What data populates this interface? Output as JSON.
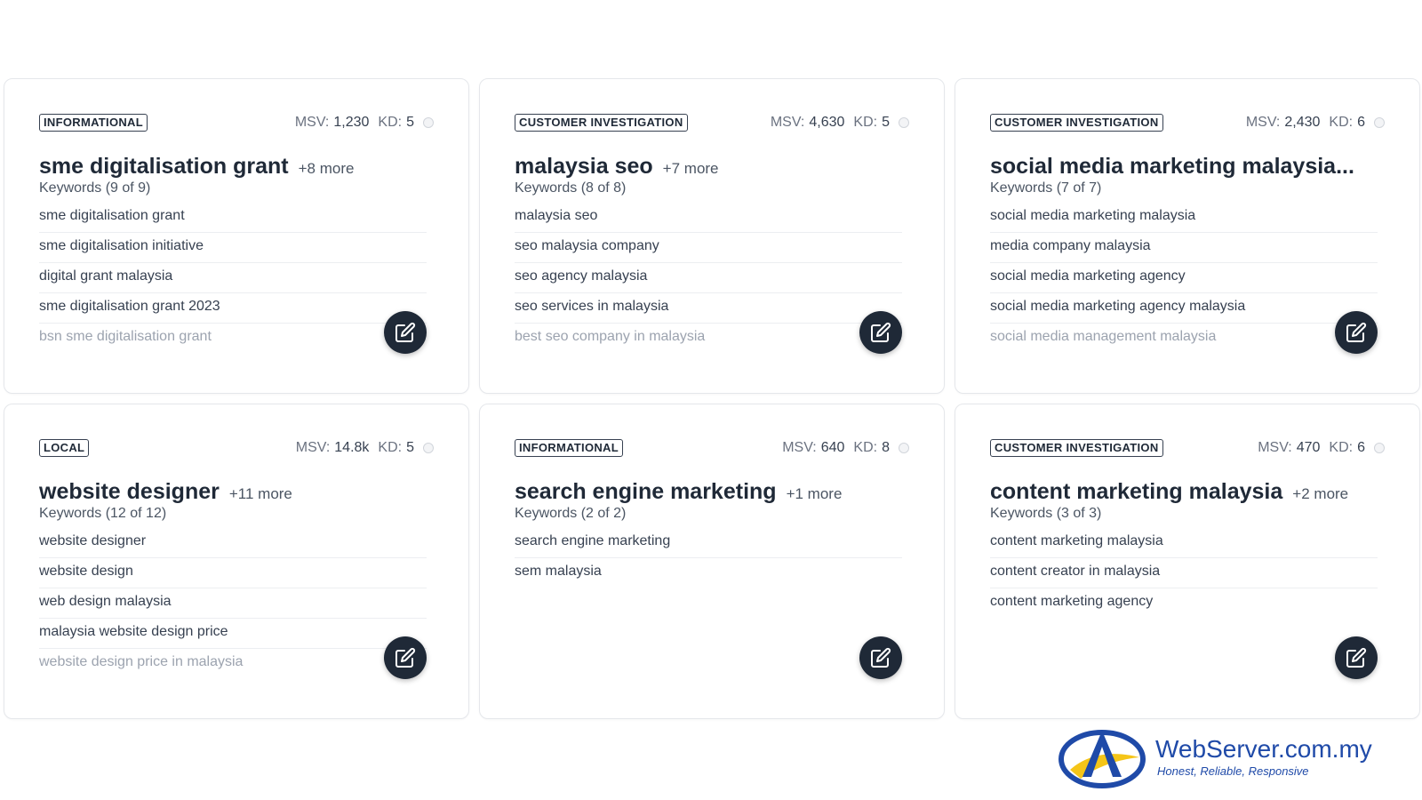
{
  "cards": [
    {
      "badge": "INFORMATIONAL",
      "msv_label": "MSV:",
      "msv": "1,230",
      "kd_label": "KD:",
      "kd": "5",
      "title": "sme digitalisation grant",
      "more": "+8 more",
      "subtitle": "Keywords (9 of 9)",
      "keywords": [
        "sme digitalisation grant",
        "sme digitalisation initiative",
        "digital grant malaysia",
        "sme digitalisation grant 2023",
        "bsn sme digitalisation grant"
      ]
    },
    {
      "badge": "CUSTOMER INVESTIGATION",
      "msv_label": "MSV:",
      "msv": "4,630",
      "kd_label": "KD:",
      "kd": "5",
      "title": "malaysia seo",
      "more": "+7 more",
      "subtitle": "Keywords (8 of 8)",
      "keywords": [
        "malaysia seo",
        "seo malaysia company",
        "seo agency malaysia",
        "seo services in malaysia",
        "best seo company in malaysia"
      ]
    },
    {
      "badge": "CUSTOMER INVESTIGATION",
      "msv_label": "MSV:",
      "msv": "2,430",
      "kd_label": "KD:",
      "kd": "6",
      "title": "social media marketing malaysia...",
      "more": "",
      "subtitle": "Keywords (7 of 7)",
      "keywords": [
        "social media marketing malaysia",
        "media company malaysia",
        "social media marketing agency",
        "social media marketing agency malaysia",
        "social media management malaysia"
      ]
    },
    {
      "badge": "LOCAL",
      "msv_label": "MSV:",
      "msv": "14.8k",
      "kd_label": "KD:",
      "kd": "5",
      "title": "website designer",
      "more": "+11 more",
      "subtitle": "Keywords (12 of 12)",
      "keywords": [
        "website designer",
        "website design",
        "web design malaysia",
        "malaysia website design price",
        "website design price in malaysia"
      ]
    },
    {
      "badge": "INFORMATIONAL",
      "msv_label": "MSV:",
      "msv": "640",
      "kd_label": "KD:",
      "kd": "8",
      "title": "search engine marketing",
      "more": "+1 more",
      "subtitle": "Keywords (2 of 2)",
      "keywords": [
        "search engine marketing",
        "sem malaysia"
      ]
    },
    {
      "badge": "CUSTOMER INVESTIGATION",
      "msv_label": "MSV:",
      "msv": "470",
      "kd_label": "KD:",
      "kd": "6",
      "title": "content marketing malaysia",
      "more": "+2 more",
      "subtitle": "Keywords (3 of 3)",
      "keywords": [
        "content marketing malaysia",
        "content creator in malaysia",
        "content marketing agency"
      ]
    }
  ],
  "logo": {
    "name": "WebServer.com.my",
    "tagline": "Honest, Reliable, Responsive"
  },
  "colors": {
    "edit_button": "#1f2937",
    "logo_blue": "#1f4aa8",
    "logo_yellow": "#f5c518"
  },
  "icons": {
    "edit": "edit-pencil-icon",
    "status": "status-dot-icon"
  }
}
